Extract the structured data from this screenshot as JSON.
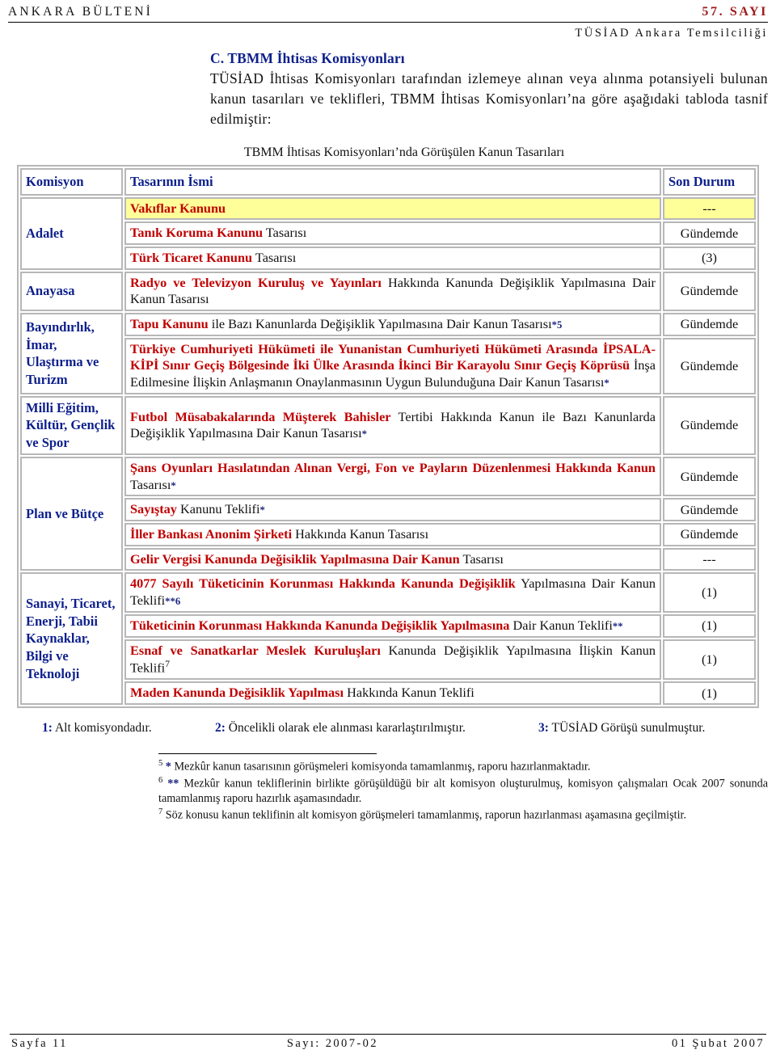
{
  "header": {
    "bulletin_name": "ANKARA BÜLTENİ",
    "issue_no": "57. SAYI",
    "office": "TÜSİAD Ankara Temsilciliği"
  },
  "intro": {
    "heading": "C. TBMM İhtisas Komisyonları",
    "body": "TÜSİAD İhtisas Komisyonları tarafından izlemeye alınan veya alınma potansiyeli bulunan kanun tasarıları ve teklifleri, TBMM İhtisas Komisyonları’na göre aşağıdaki tabloda tasnif edilmiştir:"
  },
  "table": {
    "caption": "TBMM İhtisas Komisyonları’nda Görüşülen Kanun Tasarıları",
    "columns": [
      "Komisyon",
      "Tasarının İsmi",
      "Son Durum"
    ],
    "groups": [
      {
        "komisyon": "Adalet",
        "rows": [
          {
            "law": "Vakıflar Kanunu",
            "rest": "",
            "marker": "",
            "durum": "---",
            "highlight": true,
            "one_line": true
          },
          {
            "law": "Tanık Koruma Kanunu",
            "rest": " Tasarısı",
            "marker": "",
            "durum": "Gündemde",
            "highlight": false,
            "one_line": true
          },
          {
            "law": "Türk Ticaret Kanunu",
            "rest": " Tasarısı",
            "marker": "",
            "durum": "(3)",
            "highlight": false,
            "one_line": true
          }
        ]
      },
      {
        "komisyon": "Anayasa",
        "rows": [
          {
            "law": "Radyo ve Televizyon Kuruluş ve Yayınları",
            "rest": " Hakkında Kanunda Değişiklik Yapılmasına Dair Kanun Tasarısı",
            "marker": "",
            "durum": "Gündemde",
            "highlight": false,
            "one_line": false
          }
        ]
      },
      {
        "komisyon": "Bayındırlık, İmar, Ulaştırma ve Turizm",
        "rows": [
          {
            "law": "Tapu Kanunu",
            "rest": " ile Bazı Kanunlarda Değişiklik Yapılmasına Dair Kanun Tasarısı",
            "marker": "*5",
            "durum": "Gündemde",
            "highlight": false,
            "one_line": false
          },
          {
            "law": "Türkiye Cumhuriyeti Hükümeti ile Yunanistan Cumhuriyeti Hükümeti Arasında İPSALA-KİPİ Sınır Geçiş Bölgesinde İki Ülke Arasında İkinci Bir Karayolu Sınır Geçiş Köprüsü",
            "rest": " İnşa Edilmesine İlişkin Anlaşmanın Onaylanmasının Uygun Bulunduğuna Dair Kanun Tasarısı",
            "marker": "*",
            "durum": "Gündemde",
            "highlight": false,
            "one_line": false
          }
        ]
      },
      {
        "komisyon": "Milli Eğitim, Kültür, Gençlik ve Spor",
        "rows": [
          {
            "law": "Futbol Müsabakalarında Müşterek Bahisler",
            "rest": " Tertibi Hakkında Kanun ile Bazı Kanunlarda Değişiklik Yapılmasına Dair Kanun Tasarısı",
            "marker": "*",
            "durum": "Gündemde",
            "highlight": false,
            "one_line": false
          }
        ]
      },
      {
        "komisyon": "Plan ve Bütçe",
        "rows": [
          {
            "law": "Şans Oyunları Hasılatından Alınan Vergi, Fon ve Payların Düzenlenmesi Hakkında Kanun",
            "rest": " Tasarısı",
            "marker": "*",
            "durum": "Gündemde",
            "highlight": false,
            "one_line": false
          },
          {
            "law": "Sayıştay",
            "rest": " Kanunu Teklifi",
            "marker": "*",
            "durum": "Gündemde",
            "highlight": false,
            "one_line": true
          },
          {
            "law": "İller Bankası Anonim Şirketi",
            "rest": " Hakkında Kanun Tasarısı",
            "marker": "",
            "durum": "Gündemde",
            "highlight": false,
            "one_line": true
          },
          {
            "law": "Gelir Vergisi Kanunda Değisiklik Yapılmasına Dair Kanun",
            "rest": " Tasarısı",
            "marker": "",
            "durum": "---",
            "highlight": false,
            "one_line": true
          }
        ]
      },
      {
        "komisyon": "Sanayi, Ticaret, Enerji, Tabii Kaynaklar, Bilgi ve Teknoloji",
        "rows": [
          {
            "law": "4077 Sayılı Tüketicinin Korunması Hakkında Kanunda Değişiklik",
            "rest": " Yapılmasına Dair Kanun Teklifi",
            "marker": "**6",
            "durum": "(1)",
            "highlight": false,
            "one_line": false
          },
          {
            "law": "Tüketicinin Korunması Hakkında Kanunda Değişiklik Yapılmasına",
            "rest": " Dair Kanun Teklifi",
            "marker": "**",
            "durum": "(1)",
            "highlight": false,
            "one_line": false
          },
          {
            "law": "Esnaf ve Sanatkarlar Meslek Kuruluşları",
            "rest": " Kanunda Değişiklik Yapılmasına İlişkin Kanun Teklifi",
            "marker": "7",
            "durum": "(1)",
            "highlight": false,
            "one_line": false
          },
          {
            "law": "Maden Kanunda Değisiklik Yapılması",
            "rest": " Hakkında Kanun Teklifi",
            "marker": "",
            "durum": "(1)",
            "highlight": false,
            "one_line": true
          }
        ]
      }
    ]
  },
  "legend": [
    {
      "num": "1:",
      "text": " Alt komisyondadır."
    },
    {
      "num": "2:",
      "text": " Öncelikli olarak ele alınması kararlaştırılmıştır."
    },
    {
      "num": "3:",
      "text": " TÜSİAD Görüşü sunulmuştur."
    }
  ],
  "footnotes": [
    {
      "num": "5",
      "ast": "*",
      "text": " Mezkûr kanun tasarısının görüşmeleri komisyonda tamamlanmış, raporu hazırlanmaktadır."
    },
    {
      "num": "6",
      "ast": "**",
      "text": " Mezkûr kanun tekliflerinin birlikte görüşüldüğü bir alt komisyon oluşturulmuş, komisyon çalışmaları Ocak 2007 sonunda tamamlanmış raporu hazırlık aşamasındadır."
    },
    {
      "num": "7",
      "ast": "",
      "text": " Söz konusu kanun teklifinin alt komisyon görüşmeleri tamamlanmış, raporun hazırlanması aşamasına geçilmiştir."
    }
  ],
  "footer": {
    "page": "Sayfa 11",
    "issue": "Sayı: 2007-02",
    "date": "01 Şubat 2007"
  },
  "colors": {
    "heading_blue": "#0d1f8c",
    "law_red": "#c00000",
    "issue_red": "#9e1b1b",
    "highlight_yellow": "#ffff99",
    "border_gray": "#b7b7b7"
  }
}
